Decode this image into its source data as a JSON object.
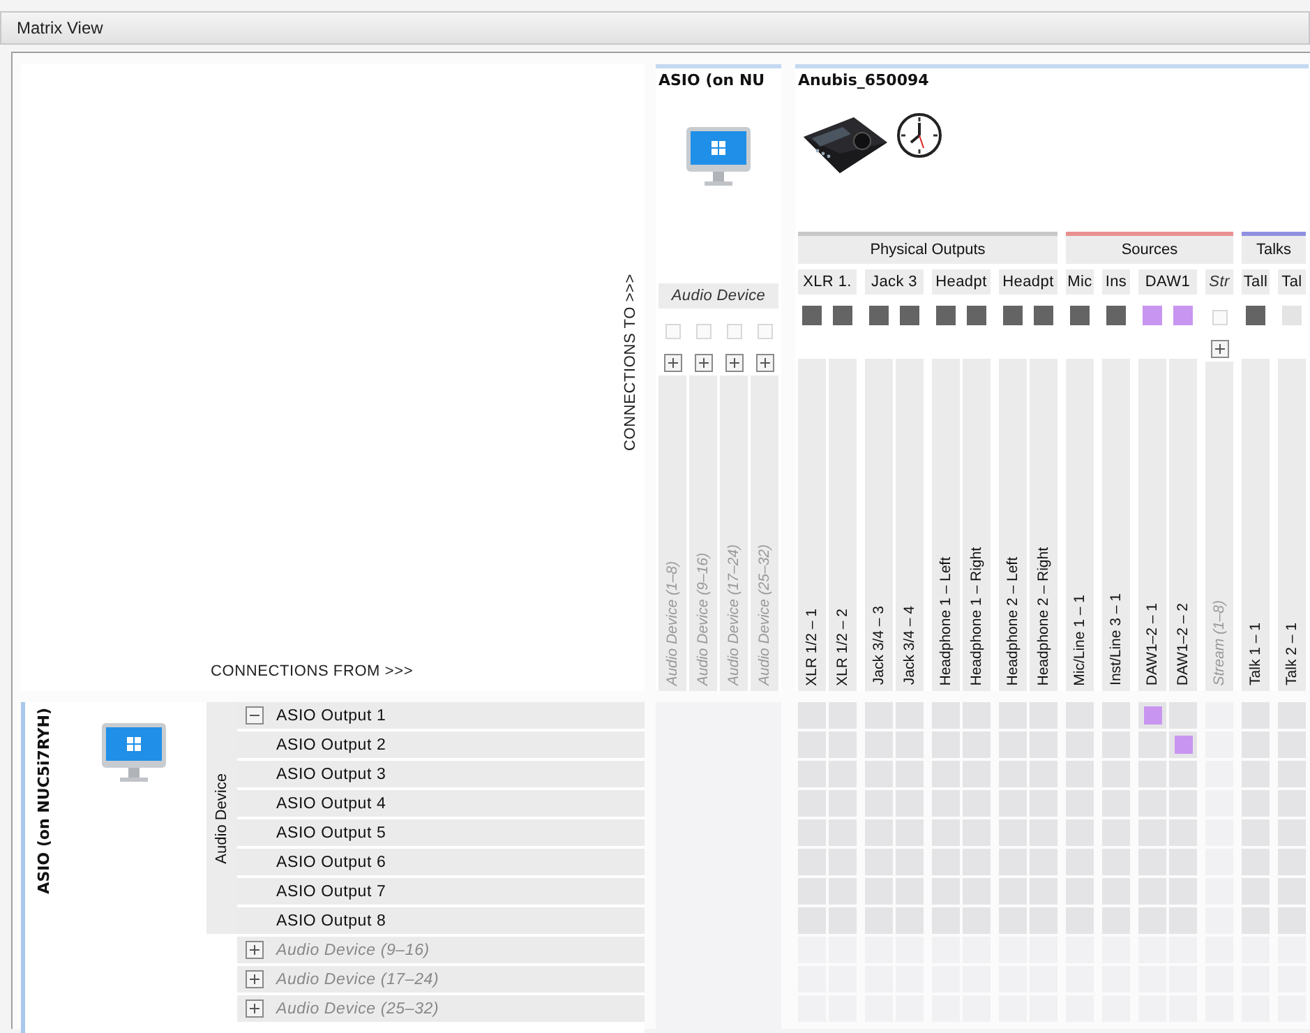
{
  "window": {
    "title": "Matrix View"
  },
  "axis_labels": {
    "from": "CONNECTIONS FROM >>>",
    "to": "CONNECTIONS TO >>>"
  },
  "destinations": [
    {
      "name": "ASIO (on NU",
      "kind": "computer",
      "sections": [
        {
          "groups": [
            {
              "label": "Audio Device",
              "collapsed": true,
              "columns": [
                {
                  "label": "Audio Device (1–8)"
                },
                {
                  "label": "Audio Device (9–16)"
                },
                {
                  "label": "Audio Device (17–24)"
                },
                {
                  "label": "Audio Device (25–32)"
                }
              ]
            }
          ]
        }
      ]
    },
    {
      "name": "Anubis_650094",
      "kind": "interface",
      "sections": [
        {
          "label": "Physical Outputs",
          "color": "#c8c8c8",
          "groups": [
            {
              "label": "XLR 1.",
              "collapsed": false,
              "columns": [
                {
                  "label": "XLR 1/2 – 1",
                  "color": "#646464"
                },
                {
                  "label": "XLR 1/2 – 2",
                  "color": "#646464"
                }
              ]
            },
            {
              "label": "Jack 3",
              "collapsed": false,
              "columns": [
                {
                  "label": "Jack 3/4 – 3",
                  "color": "#646464"
                },
                {
                  "label": "Jack 3/4 – 4",
                  "color": "#646464"
                }
              ]
            },
            {
              "label": "Headpt",
              "collapsed": false,
              "columns": [
                {
                  "label": "Headphone 1 – Left",
                  "color": "#646464"
                },
                {
                  "label": "Headphone 1 – Right",
                  "color": "#646464"
                }
              ]
            },
            {
              "label": "Headpt",
              "collapsed": false,
              "columns": [
                {
                  "label": "Headphone 2 – Left",
                  "color": "#646464"
                },
                {
                  "label": "Headphone 2 – Right",
                  "color": "#646464"
                }
              ]
            }
          ]
        },
        {
          "label": "Sources",
          "color": "#e89090",
          "groups": [
            {
              "label": "Mic",
              "collapsed": false,
              "columns": [
                {
                  "label": "Mic/Line 1 – 1",
                  "color": "#646464"
                }
              ]
            },
            {
              "label": "Ins",
              "collapsed": false,
              "columns": [
                {
                  "label": "Inst/Line 3 – 1",
                  "color": "#646464"
                }
              ]
            },
            {
              "label": "DAW1",
              "collapsed": false,
              "columns": [
                {
                  "label": "DAW1–2 – 1",
                  "color": "#c896f0"
                },
                {
                  "label": "DAW1–2 – 2",
                  "color": "#c896f0"
                }
              ]
            },
            {
              "label": "Str",
              "collapsed": true,
              "columns": [
                {
                  "label": "Stream (1–8)"
                }
              ]
            }
          ]
        },
        {
          "label": "Talks",
          "color": "#9090e0",
          "groups": [
            {
              "label": "Tall",
              "collapsed": false,
              "columns": [
                {
                  "label": "Talk 1 – 1",
                  "color": "#646464"
                }
              ]
            },
            {
              "label": "Tal",
              "collapsed": false,
              "columns": [
                {
                  "label": "Talk 2 – 1",
                  "color": "#e4e4e4"
                }
              ]
            }
          ]
        }
      ]
    }
  ],
  "sources": [
    {
      "name": "ASIO (on NUC5i7RYH)",
      "kind": "computer",
      "groups": [
        {
          "label": "Audio Device",
          "expanded": true,
          "channels": [
            {
              "label": "ASIO Output 1",
              "connected": [
                false,
                false,
                false,
                false,
                false,
                false,
                false,
                false,
                false,
                false,
                true,
                false,
                false,
                false,
                false
              ]
            },
            {
              "label": "ASIO Output 2",
              "connected": [
                false,
                false,
                false,
                false,
                false,
                false,
                false,
                false,
                false,
                false,
                false,
                true,
                false,
                false,
                false
              ]
            },
            {
              "label": "ASIO Output 3",
              "connected": [
                false,
                false,
                false,
                false,
                false,
                false,
                false,
                false,
                false,
                false,
                false,
                false,
                false,
                false,
                false
              ]
            },
            {
              "label": "ASIO Output 4",
              "connected": [
                false,
                false,
                false,
                false,
                false,
                false,
                false,
                false,
                false,
                false,
                false,
                false,
                false,
                false,
                false
              ]
            },
            {
              "label": "ASIO Output 5",
              "connected": [
                false,
                false,
                false,
                false,
                false,
                false,
                false,
                false,
                false,
                false,
                false,
                false,
                false,
                false,
                false
              ]
            },
            {
              "label": "ASIO Output 6",
              "connected": [
                false,
                false,
                false,
                false,
                false,
                false,
                false,
                false,
                false,
                false,
                false,
                false,
                false,
                false,
                false
              ]
            },
            {
              "label": "ASIO Output 7",
              "connected": [
                false,
                false,
                false,
                false,
                false,
                false,
                false,
                false,
                false,
                false,
                false,
                false,
                false,
                false,
                false
              ]
            },
            {
              "label": "ASIO Output 8",
              "connected": [
                false,
                false,
                false,
                false,
                false,
                false,
                false,
                false,
                false,
                false,
                false,
                false,
                false,
                false,
                false
              ]
            }
          ]
        },
        {
          "label": "Audio Device (9–16)",
          "expanded": false
        },
        {
          "label": "Audio Device (17–24)",
          "expanded": false
        },
        {
          "label": "Audio Device (25–32)",
          "expanded": false
        }
      ]
    }
  ]
}
